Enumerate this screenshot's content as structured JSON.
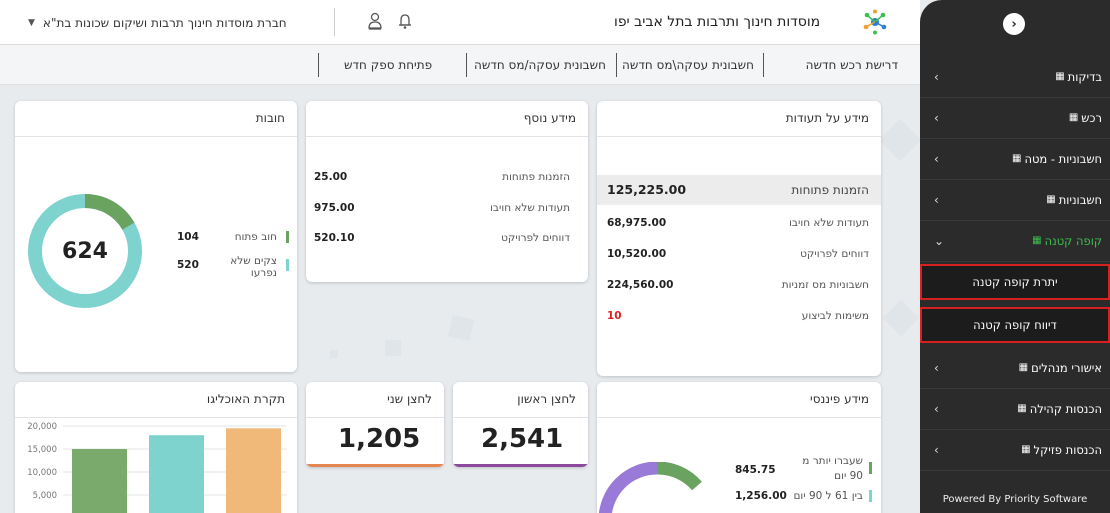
{
  "header": {
    "org_name": "מוסדות חינוך ותרבות בתל אביב יפו",
    "company_selector": "חברת מוסדות חינוך תרבות ושיקום שכונות בת\"א",
    "user_icon": "user-icon",
    "bell_icon": "bell-icon",
    "dropdown_icon": "caret-down-icon",
    "logo_icon": "star-logo-icon"
  },
  "toolbar": {
    "items": [
      "דרישת רכש חדשה",
      "חשבונית עסקה\\מס חדשה",
      "חשבונית עסקה/מס חדשה",
      "פתיחת ספק חדש"
    ]
  },
  "cards": {
    "certificates": {
      "title": "מידע על תעודות",
      "rows": [
        {
          "label": "הזמנות פתוחות",
          "value": "125,225.00"
        },
        {
          "label": "תעודות שלא חויבו",
          "value": "68,975.00"
        },
        {
          "label": "דווחים לפרויקט",
          "value": "10,520.00"
        },
        {
          "label": "חשבוניות מס זמניות",
          "value": "224,560.00"
        },
        {
          "label": "משימות לביצוע",
          "value": "10"
        }
      ]
    },
    "extra": {
      "title": "מידע נוסף",
      "rows": [
        {
          "label": "הזמנות פתוחות",
          "value": "25.00"
        },
        {
          "label": "תעודות שלא חויבו",
          "value": "975.00"
        },
        {
          "label": "דווחים לפרויקט",
          "value": "520.10"
        }
      ]
    },
    "debts": {
      "title": "חובות",
      "center_value": "624",
      "legend": [
        {
          "label": "חוב פתוח",
          "value": "104",
          "color": "#6aa25f"
        },
        {
          "label": "צקים שלא נפרעו",
          "value": "520",
          "color": "#7fd3cf"
        }
      ],
      "donut_open_fraction": 0.1667
    },
    "financial": {
      "title": "מידע פיננסי",
      "legend": [
        {
          "label": "שעברו יותר מ 90 יום",
          "value": "845.75",
          "color": "#6aa25f"
        },
        {
          "label": "בין 61 ל 90 יום",
          "value": "1,256.00",
          "color": "#7fd3cf"
        }
      ]
    },
    "button1": {
      "title": "לחצן ראשון",
      "value": "2,541",
      "accent": "#8b4a9c"
    },
    "button2": {
      "title": "לחצן שני",
      "value": "1,205",
      "accent": "#e4864f"
    },
    "population": {
      "title": "תקרת האוכליגו"
    }
  },
  "chart_data": {
    "type": "bar",
    "categories": [
      "",
      "",
      ""
    ],
    "values": [
      15000,
      18000,
      19500
    ],
    "colors": [
      "#7aab6d",
      "#7fd3cf",
      "#f0b97a"
    ],
    "ylim": [
      0,
      20000
    ],
    "yticks": [
      "20,000",
      "15,000",
      "10,000",
      "5,000"
    ],
    "title": "",
    "xlabel": "",
    "ylabel": ""
  },
  "sidebar": {
    "toggle_icon": "chevron-right-circle-icon",
    "items": [
      {
        "label": "בדיקות",
        "expanded": false
      },
      {
        "label": "רכש",
        "expanded": false
      },
      {
        "label": "חשבוניות - מטה",
        "expanded": false
      },
      {
        "label": "חשבוניות",
        "expanded": false
      },
      {
        "label": "קופה קטנה",
        "expanded": true
      },
      {
        "label": "אישורי מנהלים",
        "expanded": false
      },
      {
        "label": "הכנסות קהילה",
        "expanded": false
      },
      {
        "label": "הכנסות פזיקל",
        "expanded": false
      }
    ],
    "sub_items": [
      "יתרת קופה קטנה",
      "דיווח קופה קטנה"
    ],
    "active_color": "#3dbf4f",
    "footer": "Powered By Priority Software"
  }
}
